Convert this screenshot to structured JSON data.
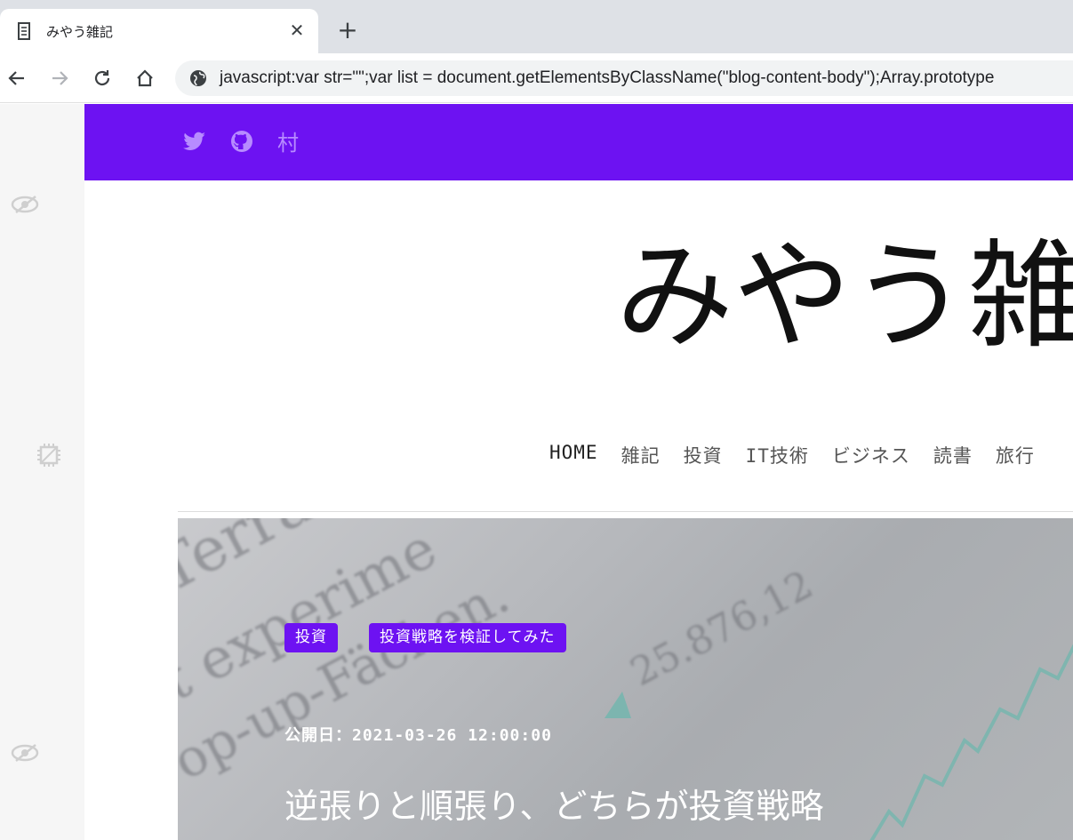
{
  "browser": {
    "tab_title": "みやう雑記",
    "tab_close_glyph": "✕",
    "new_tab_glyph": "+",
    "url": "javascript:var str=\"\";var list = document.getElementsByClassName(\"blog-content-body\");Array.prototype"
  },
  "header": {
    "social_icons": [
      "twitter-icon",
      "github-icon"
    ],
    "kanji_link": "村",
    "color": "#6d12f2"
  },
  "site": {
    "title": "みやう雑"
  },
  "nav": {
    "items": [
      "HOME",
      "雑記",
      "投資",
      "IT技術",
      "ビジネス",
      "読書",
      "旅行"
    ]
  },
  "hero": {
    "badges": [
      "投資",
      "投資戦略を検証してみた"
    ],
    "published": "公開日：2021-03-26 12:00:00",
    "title": "逆張りと順張り、どちらが投資戦略"
  }
}
